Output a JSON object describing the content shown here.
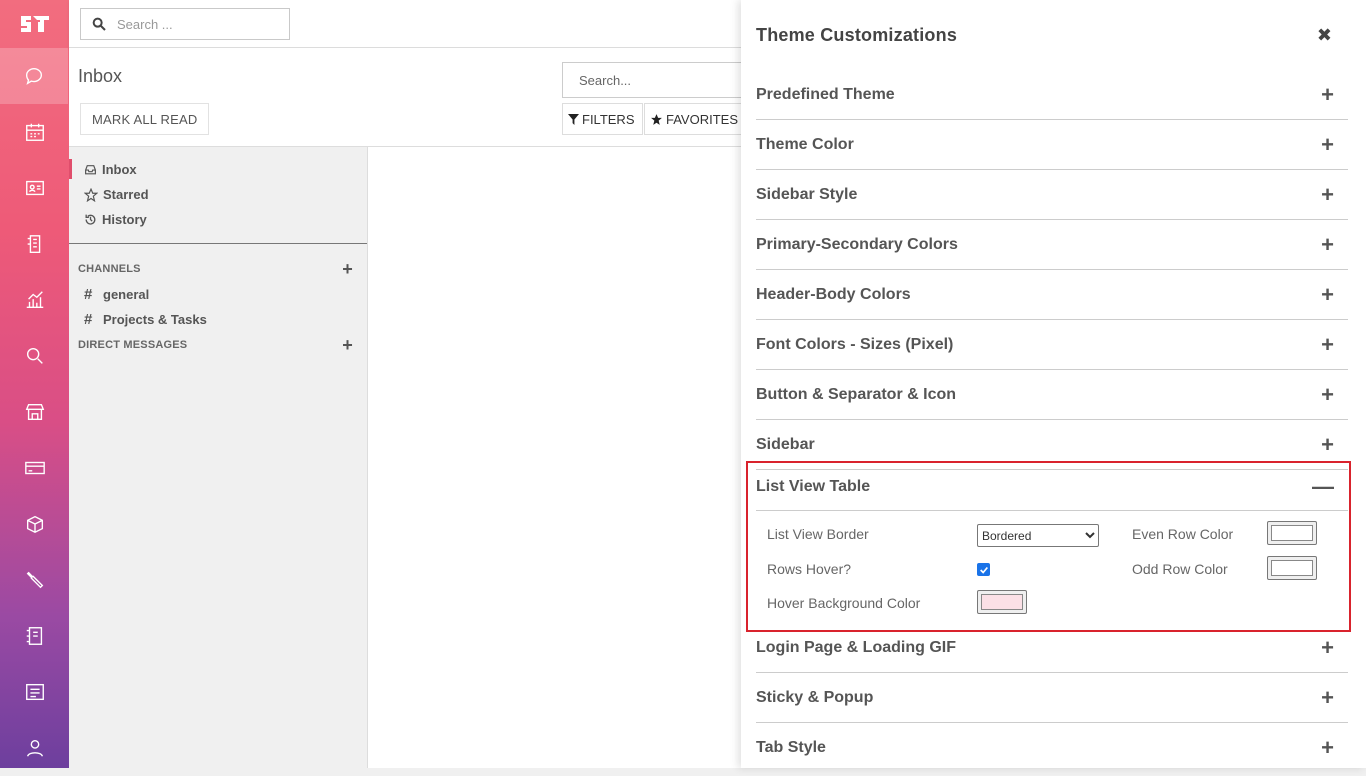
{
  "topbar": {
    "search_placeholder": "Search ..."
  },
  "control": {
    "title": "Inbox",
    "mark_all_read": "MARK ALL READ",
    "search_placeholder": "Search...",
    "filters": "FILTERS",
    "favorites": "FAVORITES"
  },
  "discuss": {
    "nav": [
      {
        "label": "Inbox",
        "icon": "inbox-icon"
      },
      {
        "label": "Starred",
        "icon": "star-icon"
      },
      {
        "label": "History",
        "icon": "history-icon"
      }
    ],
    "channels_header": "CHANNELS",
    "channels": [
      "general",
      "Projects & Tasks"
    ],
    "direct_messages_header": "DIRECT MESSAGES"
  },
  "theme": {
    "title": "Theme Customizations",
    "sections_before": [
      "Predefined Theme",
      "Theme Color",
      "Sidebar Style",
      "Primary-Secondary Colors",
      "Header-Body Colors",
      "Font Colors - Sizes (Pixel)",
      "Button & Separator & Icon",
      "Sidebar"
    ],
    "open_section": {
      "label": "List View Table",
      "list_view_border_label": "List View Border",
      "list_view_border_value": "Bordered",
      "rows_hover_label": "Rows Hover?",
      "rows_hover_checked": true,
      "hover_bg_label": "Hover Background Color",
      "hover_bg_color": "#fbe0e6",
      "even_row_label": "Even Row Color",
      "even_row_color": "#ffffff",
      "odd_row_label": "Odd Row Color",
      "odd_row_color": "#ffffff"
    },
    "sections_after": [
      "Login Page & Loading GIF",
      "Sticky & Popup",
      "Tab Style"
    ]
  },
  "colors": {
    "accent": "#e04e6c",
    "highlight_border": "#d9232d",
    "checkbox": "#1a73e8"
  }
}
